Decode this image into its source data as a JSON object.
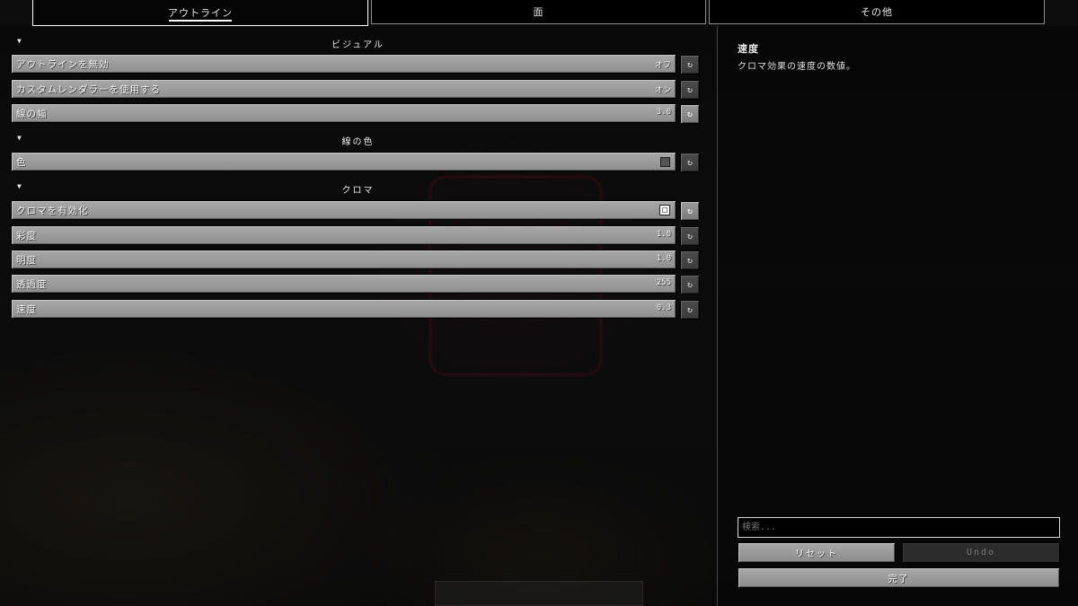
{
  "tabs": [
    {
      "label": "アウトライン"
    },
    {
      "label": "面"
    },
    {
      "label": "その他"
    }
  ],
  "sections": {
    "visual": "ビジュアル",
    "line_color": "線の色",
    "chroma": "クロマ"
  },
  "options": {
    "disable_outline": {
      "label": "アウトラインを無効",
      "value": "オフ"
    },
    "custom_renderer": {
      "label": "カスタムレンダラーを使用する",
      "value": "オン"
    },
    "line_width": {
      "label": "線の幅",
      "value": "3.0"
    },
    "color": {
      "label": "色",
      "swatch": "#555555"
    },
    "enable_chroma": {
      "label": "クロマを有効化",
      "checked": true
    },
    "saturation": {
      "label": "彩度",
      "value": "1.0"
    },
    "brightness": {
      "label": "明度",
      "value": "1.0"
    },
    "opacity": {
      "label": "透過度",
      "value": "255"
    },
    "speed": {
      "label": "速度",
      "value": "0.3"
    }
  },
  "reset_icon": "↻",
  "description": {
    "title": "速度",
    "text": "クロマ効果の速度の数値。"
  },
  "search": {
    "placeholder": "検索..."
  },
  "buttons": {
    "reset": "リセット",
    "undo": "Undo",
    "done": "完了"
  }
}
